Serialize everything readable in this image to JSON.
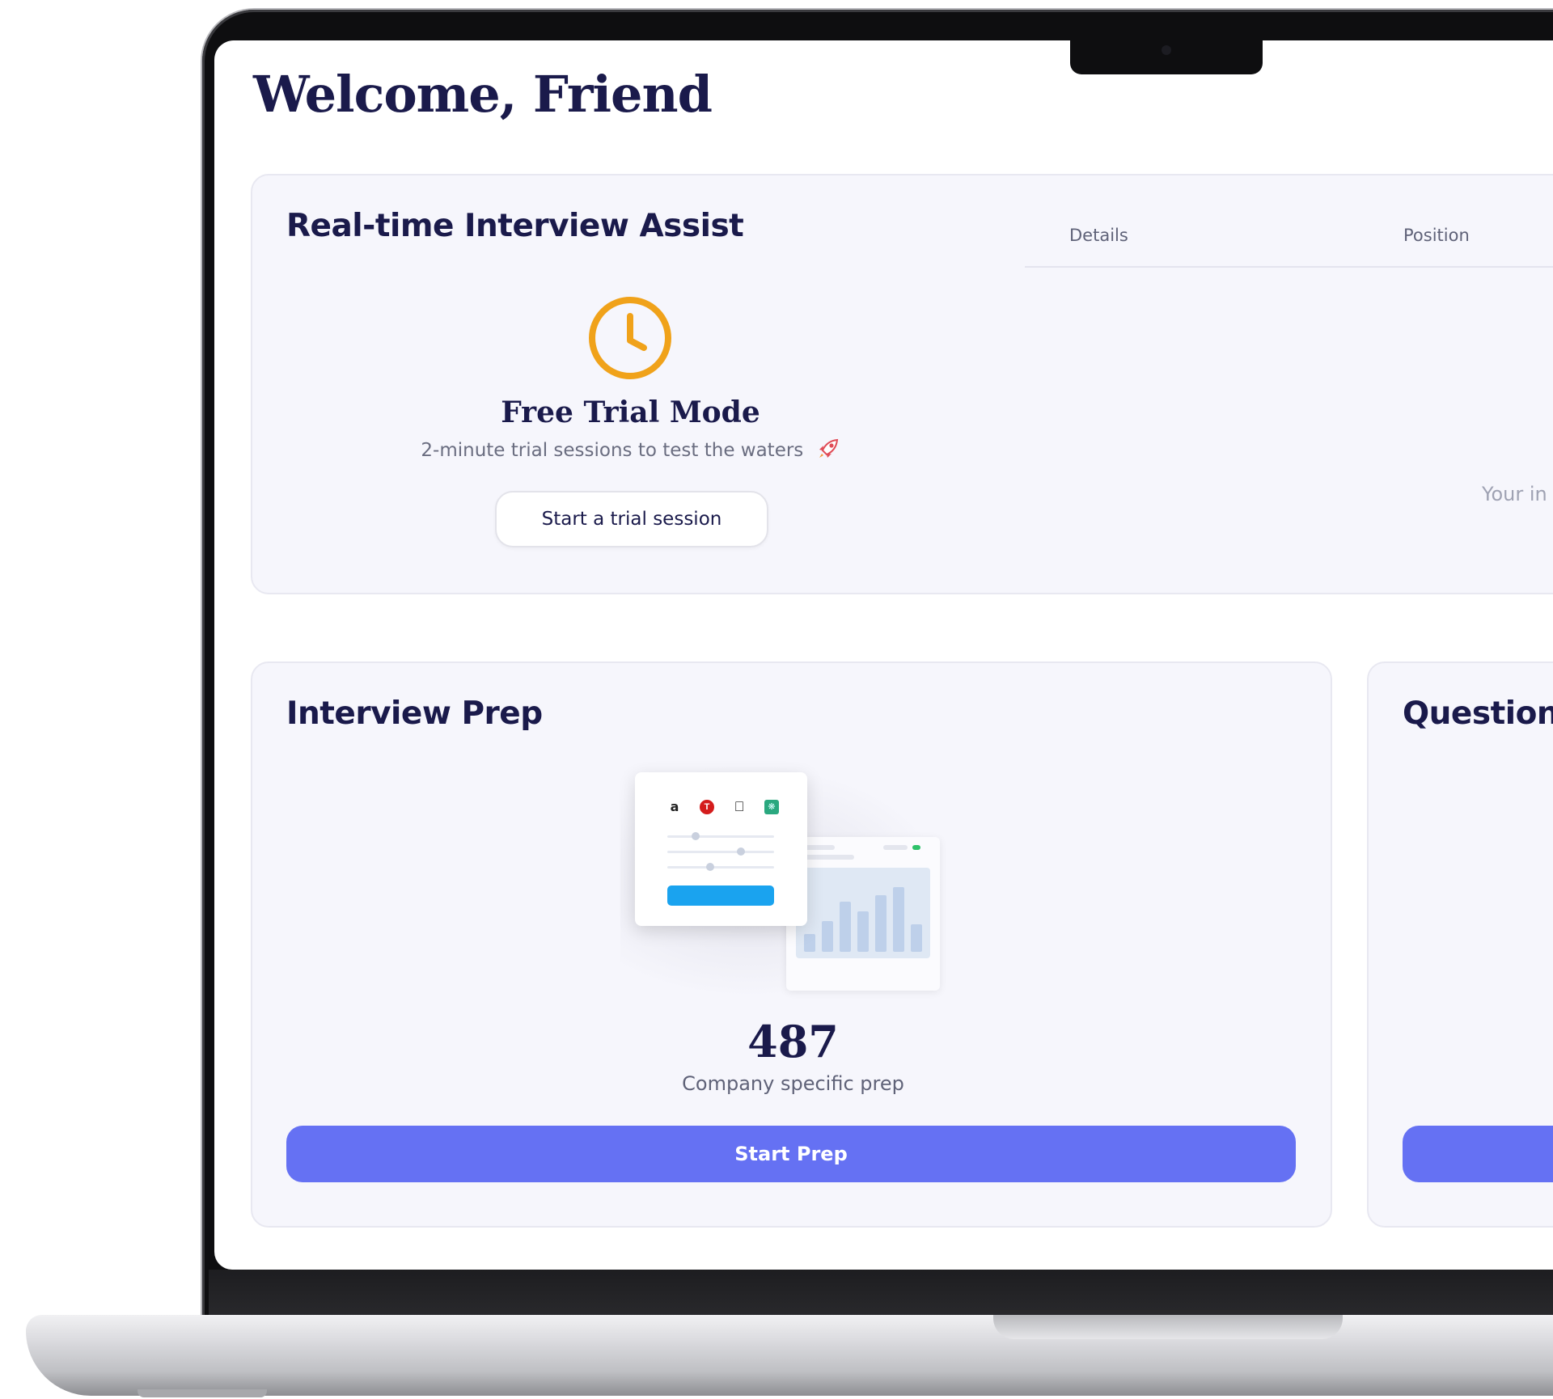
{
  "page": {
    "title": "Welcome, Friend"
  },
  "realtime_assist": {
    "title": "Real-time Interview Assist",
    "columns": [
      "Details",
      "Position"
    ],
    "trial": {
      "icon": "clock-icon",
      "title": "Free Trial Mode",
      "subtitle": "2-minute trial sessions to test the waters",
      "subtitle_icon": "rocket-icon",
      "button_label": "Start a trial session"
    },
    "empty_hint": "Your in"
  },
  "interview_prep": {
    "title": "Interview Prep",
    "illustration": {
      "logos": [
        "a",
        "T",
        "apple-logo-icon",
        "chatgpt-logo-icon"
      ]
    },
    "count": "487",
    "count_label": "Company specific prep",
    "button_label": "Start Prep"
  },
  "question_card": {
    "title": "Question"
  },
  "colors": {
    "title": "#1a1a4b",
    "card_bg": "#f6f6fc",
    "primary": "#6571f3",
    "clock_accent": "#f0a21a"
  }
}
